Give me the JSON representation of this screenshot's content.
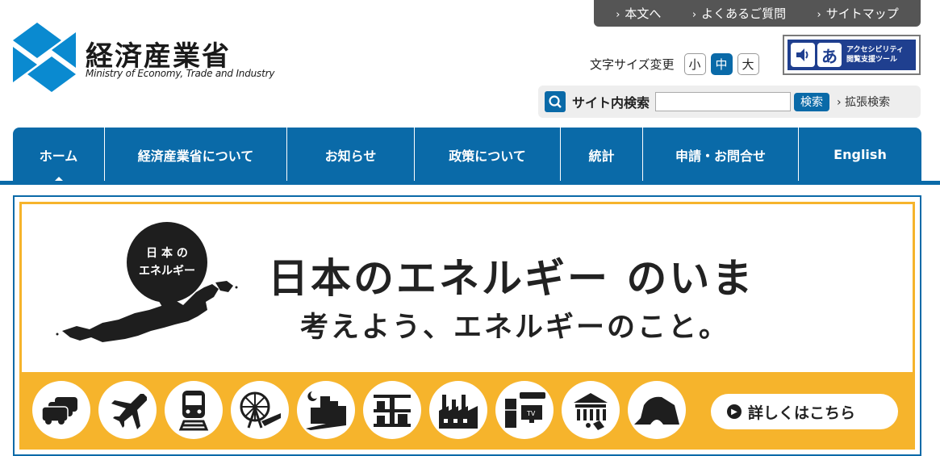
{
  "top_links": [
    {
      "label": "本文へ"
    },
    {
      "label": "よくあるご質問"
    },
    {
      "label": "サイトマップ"
    }
  ],
  "logo": {
    "jp": "経済産業省",
    "en": "Ministry of Economy, Trade and Industry"
  },
  "font_size": {
    "label": "文字サイズ変更",
    "small": "小",
    "medium": "中",
    "large": "大",
    "selected": "中"
  },
  "accessibility": {
    "line1": "アクセシビリティ",
    "line2": "閲覧支援ツール"
  },
  "search": {
    "label": "サイト内検索",
    "value": "",
    "button": "検索",
    "advanced": "拡張検索"
  },
  "nav": [
    {
      "label": "ホーム"
    },
    {
      "label": "経済産業省について"
    },
    {
      "label": "お知らせ"
    },
    {
      "label": "政策について"
    },
    {
      "label": "統計"
    },
    {
      "label": "申請・お問合せ"
    },
    {
      "label": "English"
    }
  ],
  "banner": {
    "badge_line1": "日 本 の",
    "badge_line2": "エネルギー",
    "title": "日本のエネルギー のいま",
    "subtitle": "考えよう、エネルギーのこと。",
    "more": "詳しくはこちら",
    "icons": [
      "car-icon",
      "airplane-icon",
      "train-icon",
      "ferris-wheel-icon",
      "night-city-icon",
      "warehouse-icon",
      "factory-icon",
      "appliances-icon",
      "building-icon",
      "house-icon"
    ]
  },
  "colors": {
    "brand_blue": "#0a6aa8",
    "banner_yellow": "#f6b42c",
    "dark_gray": "#555555"
  }
}
